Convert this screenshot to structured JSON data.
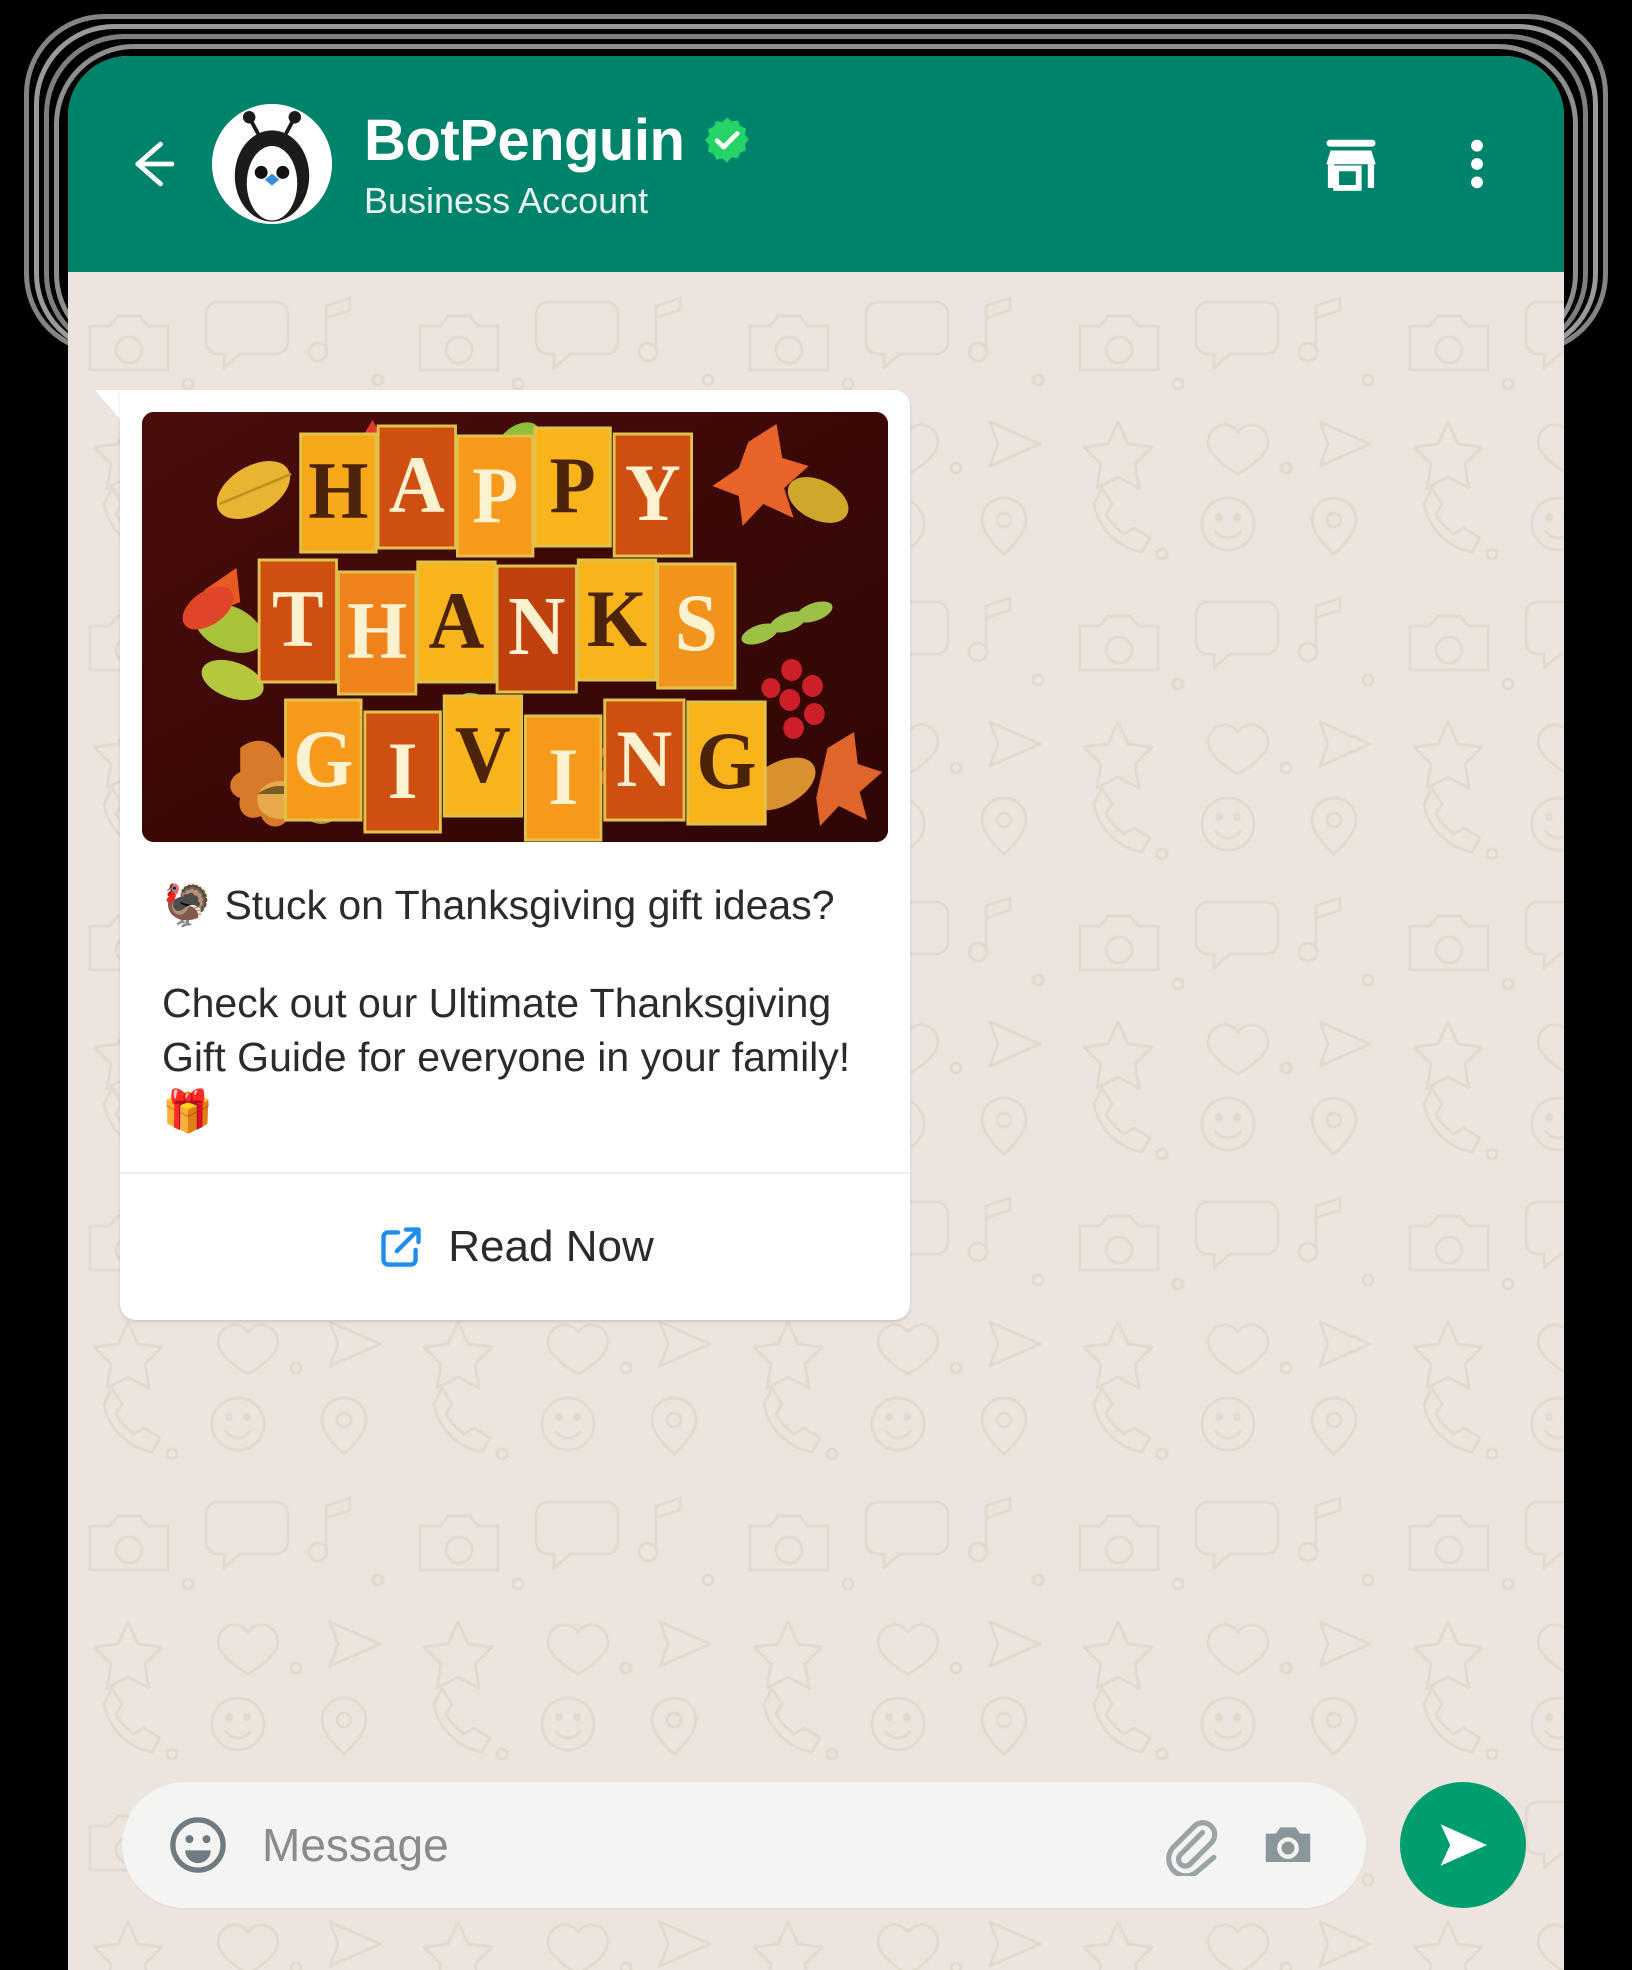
{
  "header": {
    "back_icon": "back-arrow-icon",
    "avatar_icon": "botpenguin-avatar",
    "title": "BotPenguin",
    "verified_icon": "verified-badge-icon",
    "subtitle": "Business Account",
    "store_icon": "storefront-icon",
    "menu_icon": "three-dot-menu-icon",
    "bar_color": "#00836b",
    "verified_color": "#25D366"
  },
  "chat": {
    "background_color": "#ece5dd",
    "message": {
      "media_alt": "Happy Thanksgiving letter tiles with autumn leaves",
      "media_words": [
        "HAPPY",
        "THANKS",
        "GIVING"
      ],
      "headline": "🦃 Stuck on Thanksgiving gift ideas?",
      "body": "Check out our Ultimate Thanksgiving Gift Guide for everyone in your family! 🎁",
      "cta_label": "Read Now",
      "cta_icon": "external-link-icon",
      "cta_color": "#1f8cf0"
    }
  },
  "composer": {
    "emoji_icon": "emoji-smiley-icon",
    "placeholder": "Message",
    "value": "",
    "attach_icon": "paperclip-icon",
    "camera_icon": "camera-icon",
    "send_icon": "send-arrow-icon",
    "send_color": "#009e6e"
  }
}
